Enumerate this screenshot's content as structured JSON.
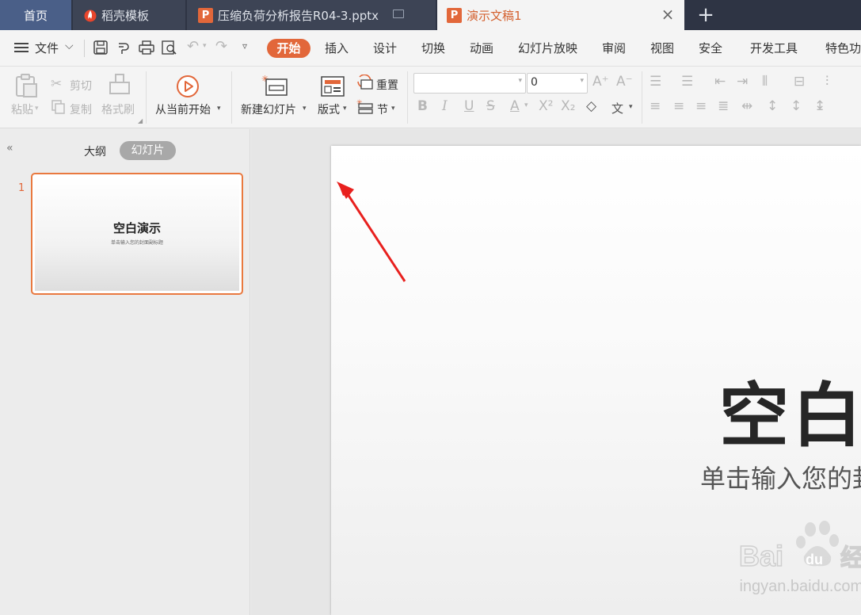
{
  "tabs": {
    "home": "首页",
    "daoke": "稻壳模板",
    "pptx": "压缩负荷分析报告R04-3.pptx",
    "active": "演示文稿1",
    "p_glyph": "P"
  },
  "menu": {
    "file": "文件",
    "items": [
      "开始",
      "插入",
      "设计",
      "切换",
      "动画",
      "幻灯片放映",
      "审阅",
      "视图",
      "安全",
      "开发工具",
      "特色功"
    ]
  },
  "ribbon": {
    "paste": "粘贴",
    "cut": "剪切",
    "copy": "复制",
    "format_painter": "格式刷",
    "from_current": "从当前开始",
    "new_slide": "新建幻灯片",
    "layout": "版式",
    "reset": "重置",
    "section": "节",
    "font_size": "0"
  },
  "left_panel": {
    "outline_tab": "大纲",
    "slides_tab": "幻灯片",
    "slide_number": "1",
    "thumb_title": "空白演示",
    "thumb_subtitle": "单击输入您的封面副标题"
  },
  "slide": {
    "title": "空白演示",
    "subtitle": "单击输入您的封面副标题"
  },
  "watermark": {
    "brand": "Bai du 经验",
    "url": "jingyan.baidu.com"
  },
  "colors": {
    "accent": "#e2673a",
    "arrow": "#e8201e",
    "tabbar": "#2e3444"
  }
}
